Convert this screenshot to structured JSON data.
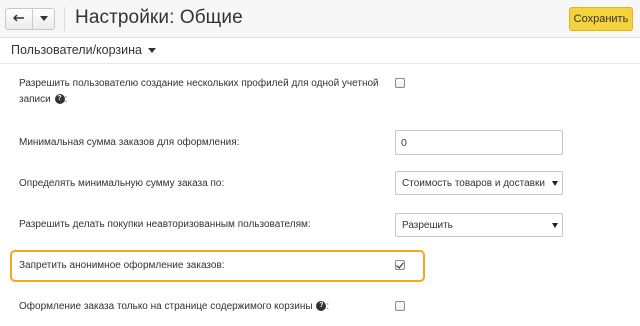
{
  "header": {
    "title": "Настройки: Общие",
    "save_label": "Сохранить"
  },
  "section": {
    "title": "Пользователи/корзина"
  },
  "settings": {
    "multi_profile": {
      "label_line1": "Разрешить пользователю создание нескольких профилей для одной учетной",
      "label_line2": "записи",
      "label_suffix": ":",
      "help": "?",
      "checked": false
    },
    "min_sum": {
      "label": "Минимальная сумма заказов для оформления:",
      "value": "0"
    },
    "min_sum_mode": {
      "label": "Определять минимальную сумму заказа по:",
      "selected": "Стоимость товаров и доставки"
    },
    "guest_purchase": {
      "label": "Разрешить делать покупки неавторизованным пользователям:",
      "selected": "Разрешить"
    },
    "forbid_anonymous": {
      "label": "Запретить анонимное оформление заказов:",
      "checked": true
    },
    "cart_page_only": {
      "label": "Оформление заказа только на странице содержимого корзины",
      "label_suffix": ":",
      "help": "?",
      "checked": false
    }
  },
  "colors": {
    "save_button": "#f5d33f",
    "highlight": "#f5a623"
  }
}
